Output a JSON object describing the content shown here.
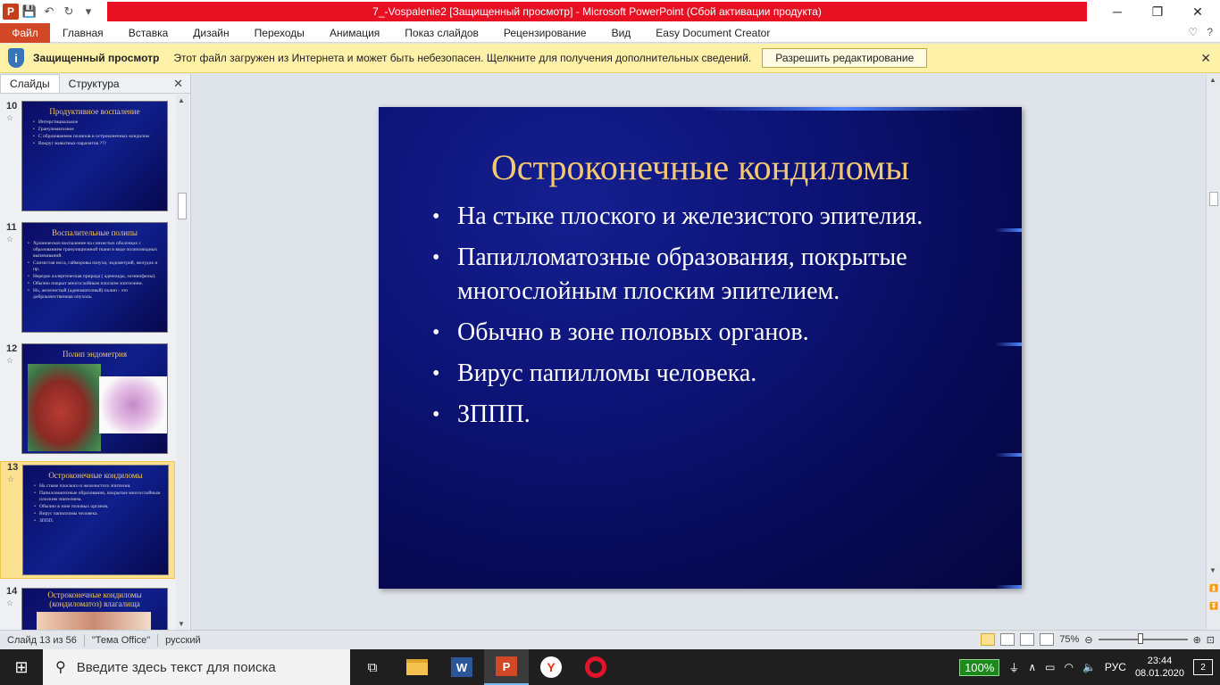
{
  "titlebar": {
    "title": "7_-Vospalenie2 [Защищенный просмотр] - Microsoft PowerPoint (Сбой активации продукта)",
    "app_letter": "P"
  },
  "ribbon": {
    "file": "Файл",
    "tabs": [
      "Главная",
      "Вставка",
      "Дизайн",
      "Переходы",
      "Анимация",
      "Показ слайдов",
      "Рецензирование",
      "Вид",
      "Easy Document Creator"
    ]
  },
  "protected": {
    "title": "Защищенный просмотр",
    "message": "Этот файл загружен из Интернета и может быть небезопасен. Щелкните для получения дополнительных сведений.",
    "button": "Разрешить редактирование"
  },
  "panel": {
    "tabs": [
      "Слайды",
      "Структура"
    ]
  },
  "thumbnails": [
    {
      "num": "10",
      "title": "Продуктивное воспаление",
      "bullets": [
        "Интерстициальное",
        "Гранулематозное",
        "С образованием полипов и остроконечных кондилом",
        "Вокруг животных-паразитов ???"
      ]
    },
    {
      "num": "11",
      "title": "Воспалительные полипы",
      "bullets": [
        "Хроническое воспаление на слизистых оболочках с образованием грануляционной ткани в виде полиповидных выпячиваний.",
        "Слизистая носа, гайморовы пазухи, эндометрий, желудок и пр.",
        "Нередко аллергическая природа ( аденоиды, эозинофилы).",
        "Обычно покрыт многослойным плоским эпителием.",
        "Но, железистый (аденоматозный) полип - это доброкачественная опухоль."
      ]
    },
    {
      "num": "12",
      "title": "Полип эндометрия",
      "bullets": []
    },
    {
      "num": "13",
      "title": "Остроконечные кондиломы",
      "bullets": [
        "На стыке плоского и железистого эпителия.",
        "Папилломатозные образования, покрытые многослойным плоским эпителием.",
        "Обычно в зоне половых органов.",
        "Вирус папилломы человека.",
        "ЗППП."
      ]
    },
    {
      "num": "14",
      "title": "Остроконечные кондиломы (кондиломатоз) влагалища",
      "bullets": []
    }
  ],
  "slide": {
    "title": "Остроконечные кондиломы",
    "bullets": [
      "На стыке плоского и железистого эпителия.",
      "Папилломатозные образования, покрытые многослойным плоским эпителием.",
      "Обычно в зоне половых органов.",
      "Вирус папилломы человека.",
      "ЗППП."
    ]
  },
  "status": {
    "slide_counter": "Слайд 13 из 56",
    "theme": "\"Тема Office\"",
    "language": "русский",
    "zoom": "75%"
  },
  "taskbar": {
    "search_placeholder": "Введите здесь текст для поиска",
    "battery": "100%",
    "lang": "РУС",
    "time": "23:44",
    "date": "08.01.2020",
    "notif_count": "2"
  }
}
